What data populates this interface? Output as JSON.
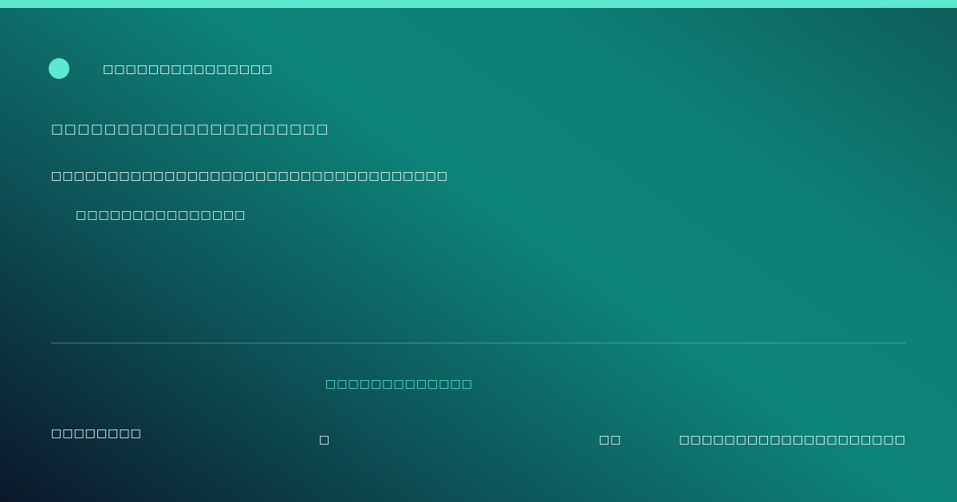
{
  "colors": {
    "accent": "#5ee8d0",
    "background_dark": "#0b1729",
    "background_teal": "#0d8479",
    "text": "#ffffff"
  },
  "brand": {
    "name": "□□□□□□□□□□□□□□□",
    "icon": "circle-logo"
  },
  "main": {
    "headline": "□□□□□□□□□□□□□□□□□□□□□",
    "subline": "□□□□□□□□□□□□□□□□□□□□□□□□□□□□□□□□□□□",
    "tagline": "□□□□□□□□□□□□□□□"
  },
  "footer": {
    "highlight": "□□□□□□□□□□□□□",
    "left": "□□□□□□□□",
    "mid_a": "□",
    "mid_b": "□□",
    "right": "□□□□□□□□□□□□□□□□□□□□"
  }
}
